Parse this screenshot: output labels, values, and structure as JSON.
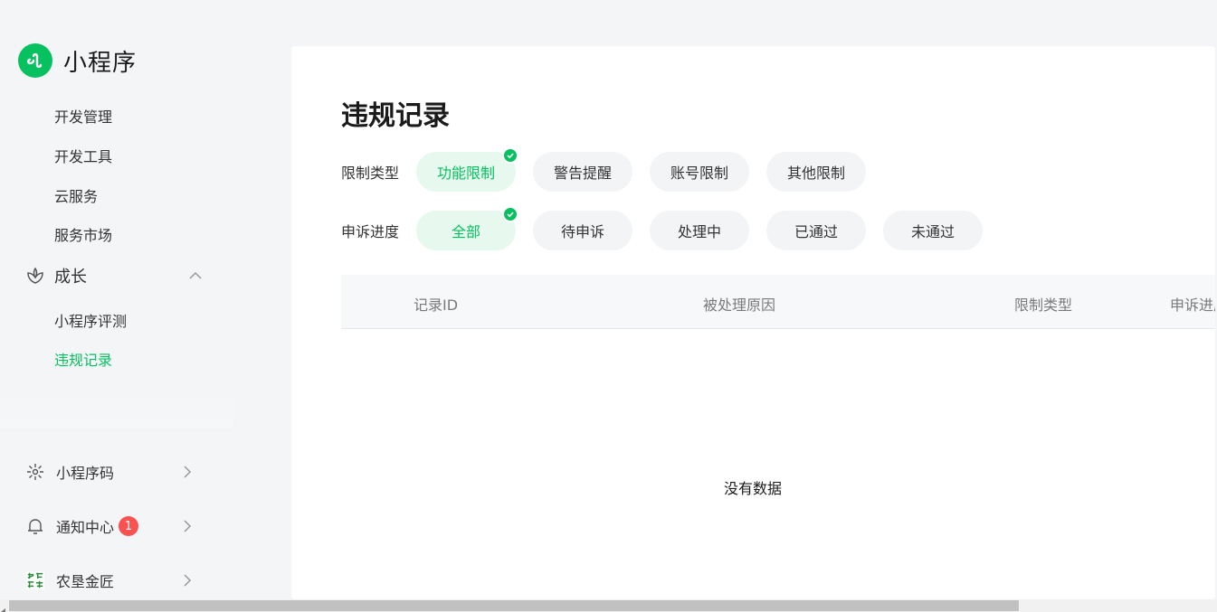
{
  "brand": {
    "title": "小程序"
  },
  "sidebar": {
    "items": [
      {
        "label": "开发管理"
      },
      {
        "label": "开发工具"
      },
      {
        "label": "云服务"
      },
      {
        "label": "服务市场"
      }
    ],
    "group": {
      "label": "成长",
      "icon": "growth-icon",
      "items": [
        {
          "label": "小程序评测"
        },
        {
          "label": "违规记录",
          "active": true
        }
      ]
    },
    "bottom": [
      {
        "label": "小程序码",
        "icon": "qrcode-icon"
      },
      {
        "label": "通知中心",
        "icon": "bell-icon",
        "badge": "1"
      },
      {
        "label": "农垦金匠",
        "icon": "account-avatar"
      }
    ]
  },
  "main": {
    "title": "违规记录",
    "filters": [
      {
        "label": "限制类型",
        "options": [
          "功能限制",
          "警告提醒",
          "账号限制",
          "其他限制"
        ],
        "selected": "功能限制"
      },
      {
        "label": "申诉进度",
        "options": [
          "全部",
          "待申诉",
          "处理中",
          "已通过",
          "未通过"
        ],
        "selected": "全部"
      }
    ],
    "table": {
      "columns": [
        "记录ID",
        "被处理原因",
        "限制类型",
        "申诉进度"
      ],
      "empty_text": "没有数据"
    }
  },
  "colors": {
    "accent": "#07c160",
    "badge": "#fa5151",
    "chip_bg": "#f3f4f6",
    "chip_selected_bg": "#e7f8ee"
  }
}
